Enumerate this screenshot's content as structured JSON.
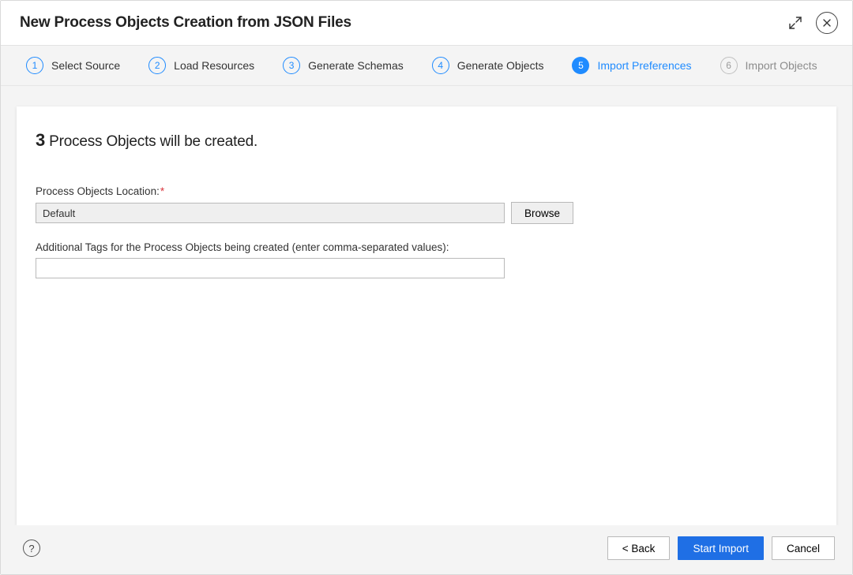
{
  "header": {
    "title": "New Process Objects Creation from JSON Files"
  },
  "stepper": {
    "steps": [
      {
        "num": "1",
        "label": "Select Source",
        "state": "done"
      },
      {
        "num": "2",
        "label": "Load Resources",
        "state": "done"
      },
      {
        "num": "3",
        "label": "Generate Schemas",
        "state": "done"
      },
      {
        "num": "4",
        "label": "Generate Objects",
        "state": "done"
      },
      {
        "num": "5",
        "label": "Import Preferences",
        "state": "active"
      },
      {
        "num": "6",
        "label": "Import Objects",
        "state": "pending"
      }
    ]
  },
  "main": {
    "summary_count": "3",
    "summary_text": " Process Objects will be created.",
    "location_label": "Process Objects Location:",
    "location_value": "Default",
    "browse_label": "Browse",
    "tags_label": "Additional Tags for the Process Objects being created (enter comma-separated values):",
    "tags_value": ""
  },
  "footer": {
    "back_label": "< Back",
    "start_label": "Start Import",
    "cancel_label": "Cancel"
  }
}
